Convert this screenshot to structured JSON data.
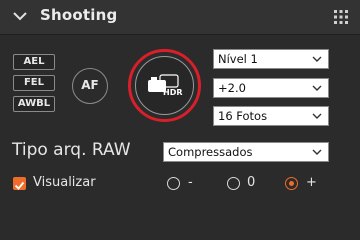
{
  "header": {
    "title": "Shooting",
    "icons": [
      "chevron-down-icon",
      "grid-menu-icon"
    ]
  },
  "lock_buttons": {
    "ael": "AEL",
    "fel": "FEL",
    "awbl": "AWBL"
  },
  "af_button": {
    "label": "AF"
  },
  "hdr_button": {
    "icon": "hdr-camera-icon",
    "icon_text": "HDR",
    "highlight_color": "#d81f2a"
  },
  "selects": {
    "level": "Nível 1",
    "exposure": "+2.0",
    "photos": "16 Fotos",
    "raw_type": "Compressados"
  },
  "raw": {
    "label": "Tipo arq. RAW"
  },
  "preview": {
    "label": "Visualizar",
    "checked": true
  },
  "radios": [
    {
      "label": "-",
      "selected": false
    },
    {
      "label": "0",
      "selected": false
    },
    {
      "label": "+",
      "selected": true
    }
  ],
  "colors": {
    "accent": "#ef6d2a",
    "panel": "#2b2b2b",
    "header": "#333333",
    "ring": "#d81f2a"
  }
}
